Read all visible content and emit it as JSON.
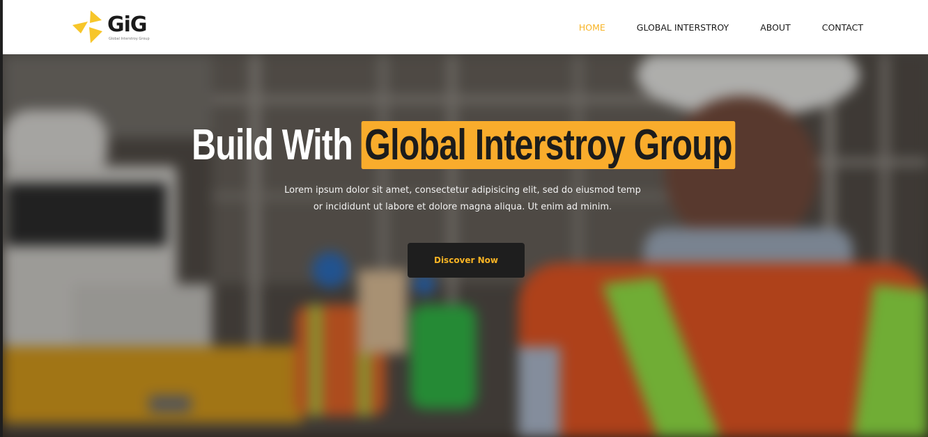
{
  "header": {
    "logo_word": "GiG",
    "logo_tagline": "Global Interstroy Group",
    "nav": [
      {
        "label": "HOME",
        "active": true
      },
      {
        "label": "GLOBAL INTERSTROY",
        "active": false
      },
      {
        "label": "ABOUT",
        "active": false
      },
      {
        "label": "CONTACT",
        "active": false
      }
    ]
  },
  "hero": {
    "title_prefix": "Build With",
    "title_highlight": "Global Interstroy Group",
    "subtitle": "Lorem ipsum dolor sit amet, consectetur adipisicing elit, sed do eiusmod temp or incididunt ut labore et dolore magna aliqua. Ut enim ad minim.",
    "cta_label": "Discover Now",
    "background_description_icon": "construction-site-photo"
  },
  "colors": {
    "accent": "#f9ac2c",
    "nav_active": "#f7b324",
    "button_bg": "#1e1e1e",
    "text_dark": "#1a1a1a"
  }
}
